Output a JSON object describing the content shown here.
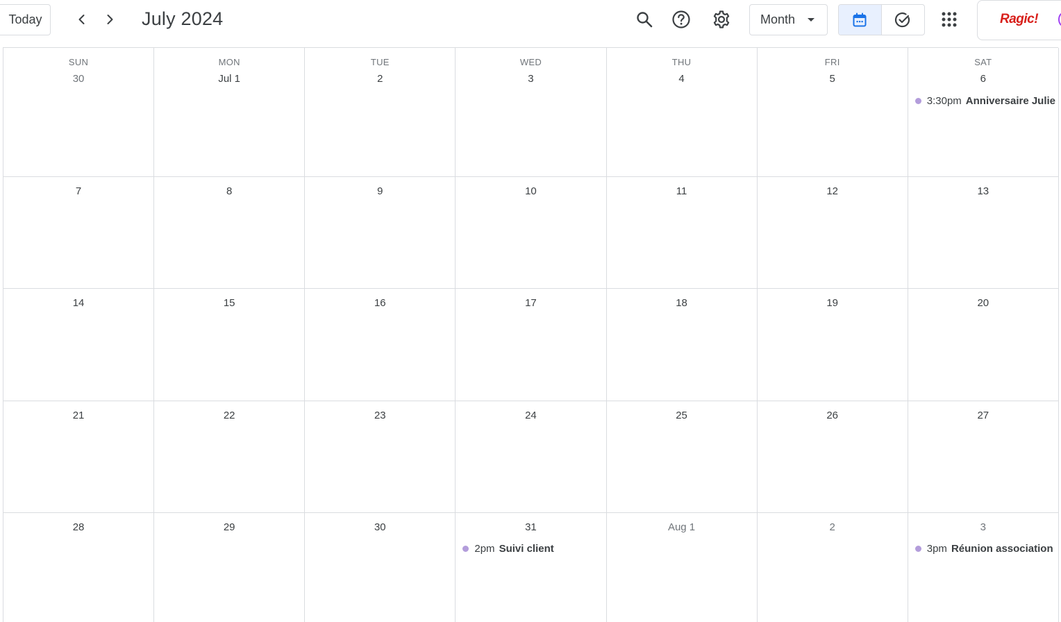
{
  "toolbar": {
    "today_label": "Today",
    "title": "July 2024",
    "view_label": "Month",
    "brand": "Ragic!"
  },
  "colors": {
    "event_dot": "#b39ddb",
    "active_toggle_bg": "#e8f0fe",
    "accent": "#1a73e8",
    "brand_red": "#d8201b"
  },
  "icons": [
    "chevron-left-icon",
    "chevron-right-icon",
    "search-icon",
    "help-icon",
    "gear-icon",
    "calendar-icon",
    "task-check-icon",
    "apps-grid-icon"
  ],
  "calendar": {
    "weekdays": [
      "SUN",
      "MON",
      "TUE",
      "WED",
      "THU",
      "FRI",
      "SAT"
    ],
    "weeks": [
      [
        {
          "label": "30",
          "muted": true,
          "events": []
        },
        {
          "label": "Jul 1",
          "events": []
        },
        {
          "label": "2",
          "events": []
        },
        {
          "label": "3",
          "events": []
        },
        {
          "label": "4",
          "events": []
        },
        {
          "label": "5",
          "events": []
        },
        {
          "label": "6",
          "events": [
            {
              "time": "3:30pm",
              "title": "Anniversaire Julie"
            }
          ]
        }
      ],
      [
        {
          "label": "7",
          "events": []
        },
        {
          "label": "8",
          "events": []
        },
        {
          "label": "9",
          "events": []
        },
        {
          "label": "10",
          "events": []
        },
        {
          "label": "11",
          "events": []
        },
        {
          "label": "12",
          "events": []
        },
        {
          "label": "13",
          "events": []
        }
      ],
      [
        {
          "label": "14",
          "events": []
        },
        {
          "label": "15",
          "events": []
        },
        {
          "label": "16",
          "events": []
        },
        {
          "label": "17",
          "events": []
        },
        {
          "label": "18",
          "events": []
        },
        {
          "label": "19",
          "events": []
        },
        {
          "label": "20",
          "events": []
        }
      ],
      [
        {
          "label": "21",
          "events": []
        },
        {
          "label": "22",
          "events": []
        },
        {
          "label": "23",
          "events": []
        },
        {
          "label": "24",
          "events": []
        },
        {
          "label": "25",
          "events": []
        },
        {
          "label": "26",
          "events": []
        },
        {
          "label": "27",
          "events": []
        }
      ],
      [
        {
          "label": "28",
          "events": []
        },
        {
          "label": "29",
          "events": []
        },
        {
          "label": "30",
          "events": []
        },
        {
          "label": "31",
          "events": [
            {
              "time": "2pm",
              "title": "Suivi client"
            }
          ]
        },
        {
          "label": "Aug 1",
          "muted": true,
          "events": []
        },
        {
          "label": "2",
          "muted": true,
          "events": []
        },
        {
          "label": "3",
          "muted": true,
          "events": [
            {
              "time": "3pm",
              "title": "Réunion association"
            }
          ]
        }
      ]
    ]
  }
}
